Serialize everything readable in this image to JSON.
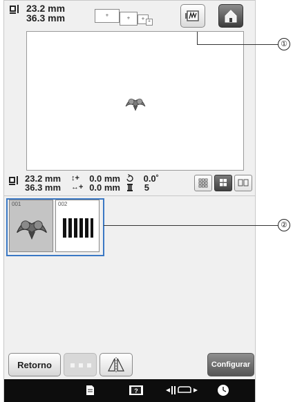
{
  "top_size": {
    "width": "23.2 mm",
    "height": "36.3 mm"
  },
  "info": {
    "width": "23.2 mm",
    "height": "36.3 mm",
    "vertical_offset": "0.0 mm",
    "horizontal_offset": "0.0 mm",
    "rotation": "0.0˚",
    "thread_changes": "5"
  },
  "patterns": [
    {
      "number": "001",
      "icon": "embroidered-motif"
    },
    {
      "number": "002",
      "icon": "bar-pattern"
    }
  ],
  "buttons": {
    "retorno": "Retorno",
    "configurar": "Configurar"
  },
  "callouts": [
    "①",
    "②"
  ],
  "colors": {
    "selection": "#3a78c4",
    "status_bar": "#0d0d0d"
  }
}
